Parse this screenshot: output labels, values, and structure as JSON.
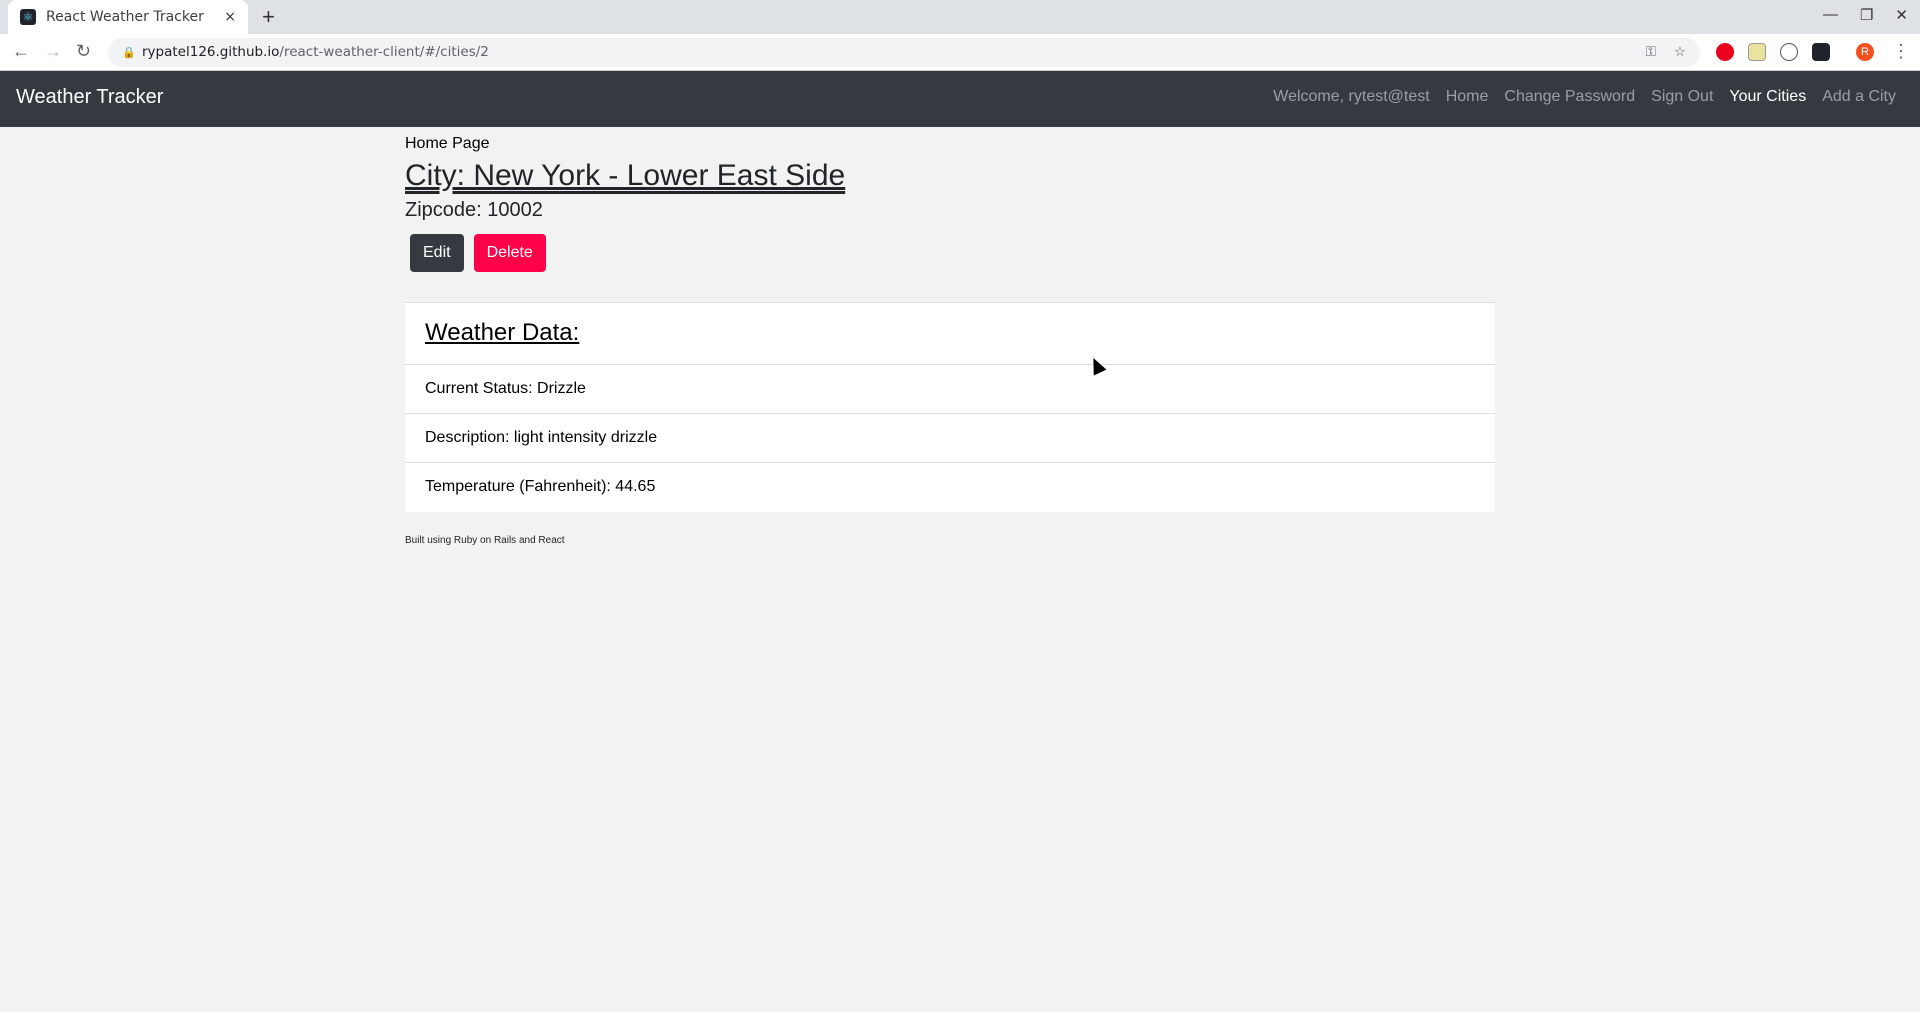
{
  "browser": {
    "tab_title": "React Weather Tracker",
    "close": "×",
    "new_tab": "+",
    "url_host": "rypatel126.github.io",
    "url_path": "/react-weather-client/#/cities/2",
    "profile_initial": "R"
  },
  "navbar": {
    "brand": "Weather Tracker",
    "links": [
      "Welcome, rytest@test",
      "Home",
      "Change Password",
      "Sign Out",
      "Your Cities",
      "Add a City"
    ]
  },
  "page": {
    "breadcrumb": "Home Page",
    "city_title": "City: New York - Lower East Side",
    "zipcode": "Zipcode: 10002",
    "edit_label": "Edit",
    "delete_label": "Delete"
  },
  "weather": {
    "header": "Weather Data:",
    "rows": [
      "Current Status: Drizzle",
      "Description: light intensity drizzle",
      "Temperature (Fahrenheit): 44.65"
    ]
  },
  "footer": "Built using Ruby on Rails and React",
  "colors": {
    "navbar": "#343a40",
    "delete": "#ff0049",
    "background": "#f2f2f2"
  }
}
